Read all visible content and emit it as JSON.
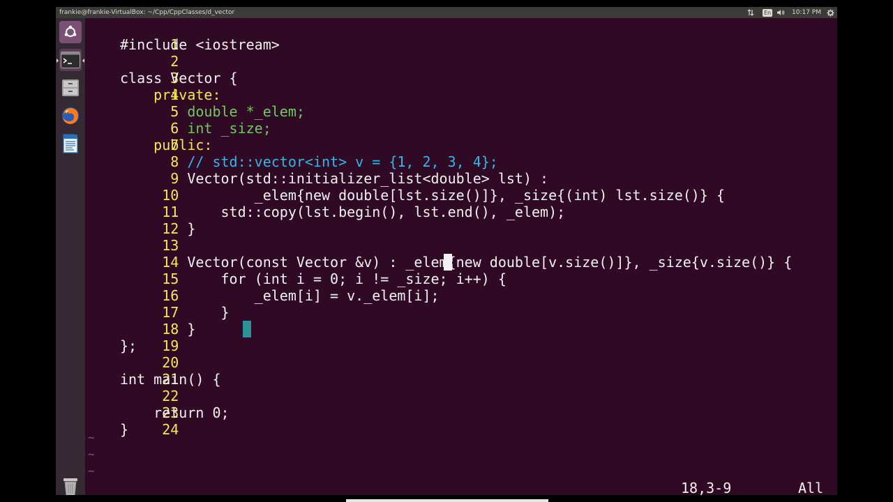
{
  "window": {
    "title": "frankie@frankie-VirtualBox: ~/Cpp/CppClasses/d_vector"
  },
  "top_panel": {
    "keyboard_layout": "En",
    "time": "10:17 PM"
  },
  "launcher": {
    "items": [
      {
        "name": "ubuntu-dash",
        "icon": "ubuntu-logo-icon"
      },
      {
        "name": "terminal",
        "icon": "terminal-icon"
      },
      {
        "name": "files",
        "icon": "file-cabinet-icon"
      },
      {
        "name": "firefox",
        "icon": "firefox-icon"
      },
      {
        "name": "libreoffice-writer",
        "icon": "document-icon"
      },
      {
        "name": "trash",
        "icon": "trash-icon"
      }
    ]
  },
  "editor": {
    "lines": [
      {
        "n": "1",
        "text": "#include <iostream>"
      },
      {
        "n": "2",
        "text": ""
      },
      {
        "n": "3",
        "text": "class Vector {"
      },
      {
        "n": "4",
        "text": "    private:"
      },
      {
        "n": "5",
        "text": "        double *_elem;"
      },
      {
        "n": "6",
        "text": "        int _size;"
      },
      {
        "n": "7",
        "text": "    public:"
      },
      {
        "n": "8",
        "text": "        // std::vector<int> v = {1, 2, 3, 4};"
      },
      {
        "n": "9",
        "text": "        Vector(std::initializer_list<double> lst) :"
      },
      {
        "n": "10",
        "text": "                _elem{new double[lst.size()]}, _size{(int) lst.size()} {"
      },
      {
        "n": "11",
        "text": "            std::copy(lst.begin(), lst.end(), _elem);"
      },
      {
        "n": "12",
        "text": "        }"
      },
      {
        "n": "13",
        "text": ""
      },
      {
        "n": "14",
        "text": "        Vector(const Vector &v) : _elem{new double[v.size()]}, _size{v.size()} {"
      },
      {
        "n": "15",
        "text": "            for (int i = 0; i != _size; i++) {"
      },
      {
        "n": "16",
        "text": "                _elem[i] = v._elem[i];"
      },
      {
        "n": "17",
        "text": "            }"
      },
      {
        "n": "18",
        "text": "        }"
      },
      {
        "n": "19",
        "text": "};"
      },
      {
        "n": "20",
        "text": ""
      },
      {
        "n": "21",
        "text": "int main() {"
      },
      {
        "n": "22",
        "text": ""
      },
      {
        "n": "23",
        "text": "    return 0;"
      },
      {
        "n": "24",
        "text": "}"
      }
    ],
    "tilde": "~",
    "status_position": "18,3-9",
    "status_scroll": "All"
  }
}
